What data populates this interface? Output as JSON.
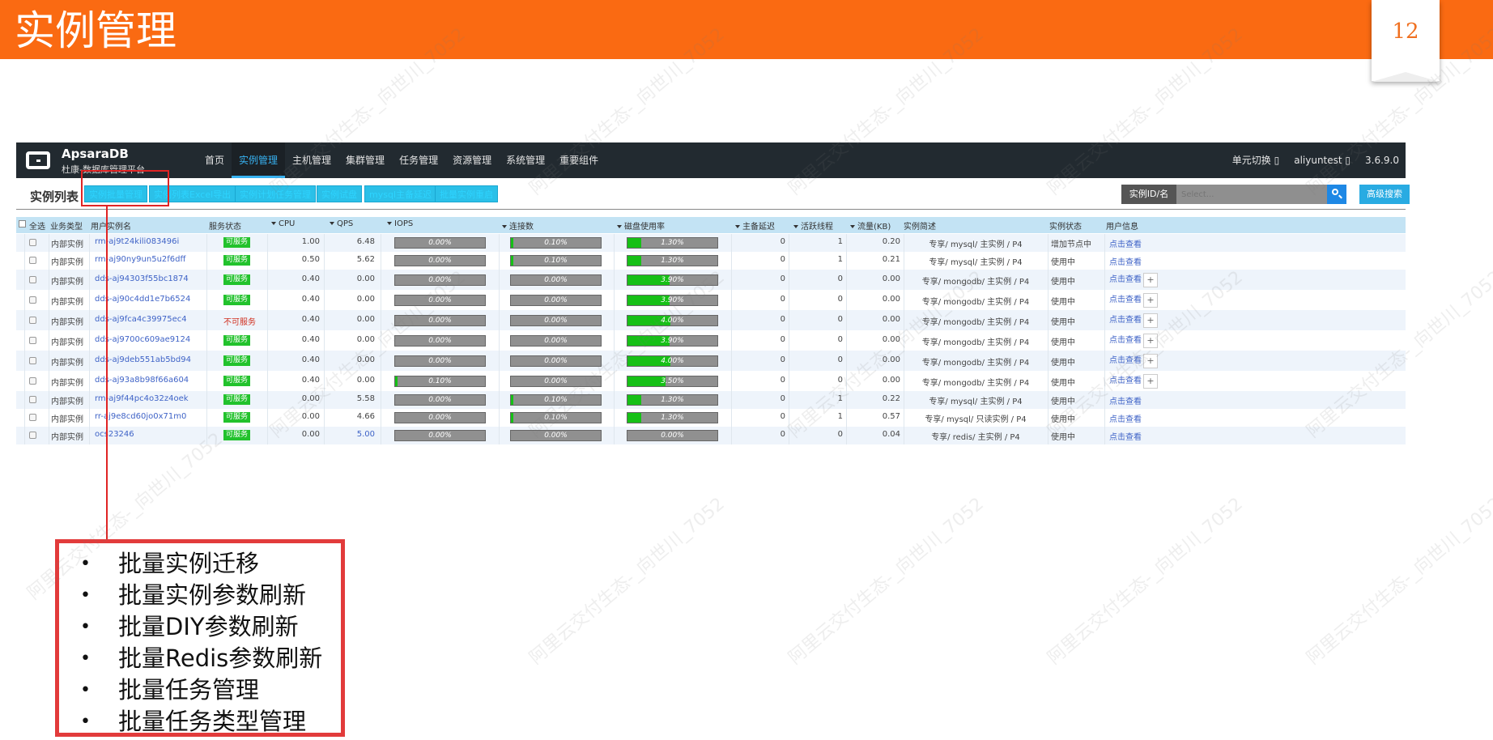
{
  "slide": {
    "title": "实例管理",
    "page_number": "12"
  },
  "app": {
    "brand": {
      "name": "ApsaraDB",
      "subtitle": "杜康-数据库管理平台"
    },
    "nav": [
      "首页",
      "实例管理",
      "主机管理",
      "集群管理",
      "任务管理",
      "资源管理",
      "系统管理",
      "重要组件"
    ],
    "nav_right": {
      "unit_switch": "单元切换 ▯",
      "user": "aliyuntest ▯",
      "version": "3.6.9.0"
    },
    "list_title": "实例列表",
    "toolbar_buttons": [
      "实例批量管理",
      "实例列表Excel导出",
      "实例计划任务管理",
      "实例试盘",
      "mysql主备延迟",
      "批量实例重启"
    ],
    "search": {
      "label": "实例ID/名",
      "placeholder": "Select...",
      "advanced": "高级搜索"
    },
    "columns": [
      "全选",
      "业务类型",
      "用户实例名",
      "服务状态",
      "CPU",
      "QPS",
      "IOPS",
      "连接数",
      "磁盘使用率",
      "主备延迟",
      "活跃线程",
      "流量(KB)",
      "实例简述",
      "实例状态",
      "用户信息"
    ],
    "rows": [
      {
        "type": "内部实例",
        "name": "rm-aj9t24kili083496i",
        "status": "可服务",
        "cpu": "1.00",
        "qps": "6.48",
        "iops": "0.00%",
        "iops_val": 0,
        "conn": "0.10%",
        "conn_val": 0.1,
        "disk": "1.30%",
        "disk_val": 1.3,
        "delay": "0",
        "threads": "1",
        "traffic": "0.20",
        "desc": "专享/ mysql/ 主实例 / P4",
        "state": "增加节点中",
        "info": "点击查看",
        "plus": false
      },
      {
        "type": "内部实例",
        "name": "rm-aj90ny9un5u2f6dff",
        "status": "可服务",
        "cpu": "0.50",
        "qps": "5.62",
        "iops": "0.00%",
        "iops_val": 0,
        "conn": "0.10%",
        "conn_val": 0.1,
        "disk": "1.30%",
        "disk_val": 1.3,
        "delay": "0",
        "threads": "1",
        "traffic": "0.21",
        "desc": "专享/ mysql/ 主实例 / P4",
        "state": "使用中",
        "info": "点击查看",
        "plus": false
      },
      {
        "type": "内部实例",
        "name": "dds-aj94303f55bc1874",
        "status": "可服务",
        "cpu": "0.40",
        "qps": "0.00",
        "iops": "0.00%",
        "iops_val": 0,
        "conn": "0.00%",
        "conn_val": 0,
        "disk": "3.90%",
        "disk_val": 3.9,
        "delay": "0",
        "threads": "0",
        "traffic": "0.00",
        "desc": "专享/ mongodb/ 主实例 / P4",
        "state": "使用中",
        "info": "点击查看",
        "plus": true
      },
      {
        "type": "内部实例",
        "name": "dds-aj90c4dd1e7b6524",
        "status": "可服务",
        "cpu": "0.40",
        "qps": "0.00",
        "iops": "0.00%",
        "iops_val": 0,
        "conn": "0.00%",
        "conn_val": 0,
        "disk": "3.90%",
        "disk_val": 3.9,
        "delay": "0",
        "threads": "0",
        "traffic": "0.00",
        "desc": "专享/ mongodb/ 主实例 / P4",
        "state": "使用中",
        "info": "点击查看",
        "plus": true
      },
      {
        "type": "内部实例",
        "name": "dds-aj9fca4c39975ec4",
        "status": "不可服务",
        "cpu": "0.40",
        "qps": "0.00",
        "iops": "0.00%",
        "iops_val": 0,
        "conn": "0.00%",
        "conn_val": 0,
        "disk": "4.00%",
        "disk_val": 4.0,
        "delay": "0",
        "threads": "0",
        "traffic": "0.00",
        "desc": "专享/ mongodb/ 主实例 / P4",
        "state": "使用中",
        "info": "点击查看",
        "plus": true
      },
      {
        "type": "内部实例",
        "name": "dds-aj9700c609ae9124",
        "status": "可服务",
        "cpu": "0.40",
        "qps": "0.00",
        "iops": "0.00%",
        "iops_val": 0,
        "conn": "0.00%",
        "conn_val": 0,
        "disk": "3.90%",
        "disk_val": 3.9,
        "delay": "0",
        "threads": "0",
        "traffic": "0.00",
        "desc": "专享/ mongodb/ 主实例 / P4",
        "state": "使用中",
        "info": "点击查看",
        "plus": true
      },
      {
        "type": "内部实例",
        "name": "dds-aj9deb551ab5bd94",
        "status": "可服务",
        "cpu": "0.40",
        "qps": "0.00",
        "iops": "0.00%",
        "iops_val": 0,
        "conn": "0.00%",
        "conn_val": 0,
        "disk": "4.00%",
        "disk_val": 4.0,
        "delay": "0",
        "threads": "0",
        "traffic": "0.00",
        "desc": "专享/ mongodb/ 主实例 / P4",
        "state": "使用中",
        "info": "点击查看",
        "plus": true
      },
      {
        "type": "内部实例",
        "name": "dds-aj93a8b98f66a604",
        "status": "可服务",
        "cpu": "0.40",
        "qps": "0.00",
        "iops": "0.10%",
        "iops_val": 0.1,
        "conn": "0.00%",
        "conn_val": 0,
        "disk": "3.50%",
        "disk_val": 3.5,
        "delay": "0",
        "threads": "0",
        "traffic": "0.00",
        "desc": "专享/ mongodb/ 主实例 / P4",
        "state": "使用中",
        "info": "点击查看",
        "plus": true
      },
      {
        "type": "内部实例",
        "name": "rm-aj9f44pc4o32z4oek",
        "status": "可服务",
        "cpu": "0.00",
        "qps": "5.58",
        "iops": "0.00%",
        "iops_val": 0,
        "conn": "0.10%",
        "conn_val": 0.1,
        "disk": "1.30%",
        "disk_val": 1.3,
        "delay": "0",
        "threads": "1",
        "traffic": "0.22",
        "desc": "专享/ mysql/ 主实例 / P4",
        "state": "使用中",
        "info": "点击查看",
        "plus": false
      },
      {
        "type": "内部实例",
        "name": "rr-aj9e8cd60jo0x71m0",
        "status": "可服务",
        "cpu": "0.00",
        "qps": "4.66",
        "iops": "0.00%",
        "iops_val": 0,
        "conn": "0.10%",
        "conn_val": 0.1,
        "disk": "1.30%",
        "disk_val": 1.3,
        "delay": "0",
        "threads": "1",
        "traffic": "0.57",
        "desc": "专享/ mysql/ 只读实例 / P4",
        "state": "使用中",
        "info": "点击查看",
        "plus": false
      },
      {
        "type": "内部实例",
        "name": "ocs23246",
        "status": "可服务",
        "cpu": "0.00",
        "qps": "5.00",
        "iops": "0.00%",
        "iops_val": 0,
        "conn": "0.00%",
        "conn_val": 0,
        "disk": "0.00%",
        "disk_val": 0,
        "delay": "0",
        "threads": "0",
        "traffic": "0.04",
        "desc": "专享/ redis/ 主实例 / P4",
        "state": "使用中",
        "info": "点击查看",
        "plus": false
      }
    ]
  },
  "callout": {
    "items": [
      "批量实例迁移",
      "批量实例参数刷新",
      "批量DIY参数刷新",
      "批量Redis参数刷新",
      "批量任务管理",
      "批量任务类型管理"
    ]
  },
  "watermark": "阿里云交付生态-_向世川_7052",
  "colors": {
    "accent": "#fa6a12",
    "nav_bg": "#222a30",
    "highlight": "#e02424",
    "status_ok": "#22c22c"
  }
}
